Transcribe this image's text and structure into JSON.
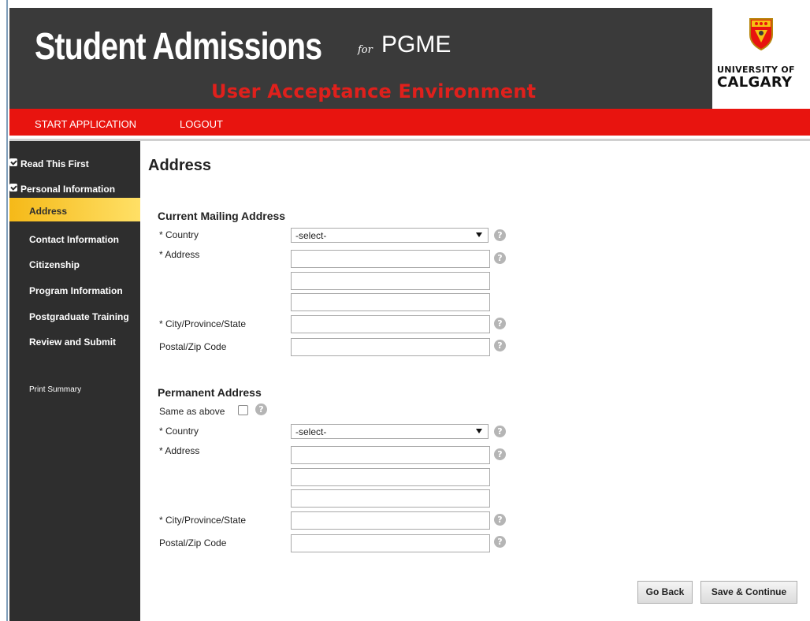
{
  "header": {
    "title": "Student Admissions",
    "for": "for",
    "program": "PGME",
    "environment": "User Acceptance Environment",
    "logo_line1": "UNIVERSITY OF",
    "logo_line2": "CALGARY"
  },
  "nav": {
    "start_application": "START APPLICATION",
    "logout": "LOGOUT"
  },
  "sidebar": {
    "items": [
      {
        "label": "Read This First",
        "checked": true
      },
      {
        "label": "Personal Information",
        "checked": true
      },
      {
        "label": "Address",
        "active": true
      },
      {
        "label": "Contact Information"
      },
      {
        "label": "Citizenship"
      },
      {
        "label": "Program Information"
      },
      {
        "label": "Postgraduate Training"
      },
      {
        "label": "Review and Submit"
      }
    ],
    "print_summary": "Print Summary"
  },
  "page": {
    "title": "Address"
  },
  "current": {
    "title": "Current Mailing Address",
    "country_label": "* Country",
    "country_value": "-select-",
    "address_label": "* Address",
    "city_label": "* City/Province/State",
    "postal_label": "Postal/Zip Code"
  },
  "permanent": {
    "title": "Permanent Address",
    "same_label": "Same as above",
    "country_label": "* Country",
    "country_value": "-select-",
    "address_label": "* Address",
    "city_label": "* City/Province/State",
    "postal_label": "Postal/Zip Code"
  },
  "help_glyph": "?",
  "buttons": {
    "go_back": "Go Back",
    "save_continue": "Save & Continue"
  },
  "colors": {
    "header_bg": "#3a3a3a",
    "nav_red": "#e8140f",
    "env_red": "#e0201c",
    "sidebar_bg": "#2e2e2e",
    "active_yellow": "#f5b918"
  }
}
